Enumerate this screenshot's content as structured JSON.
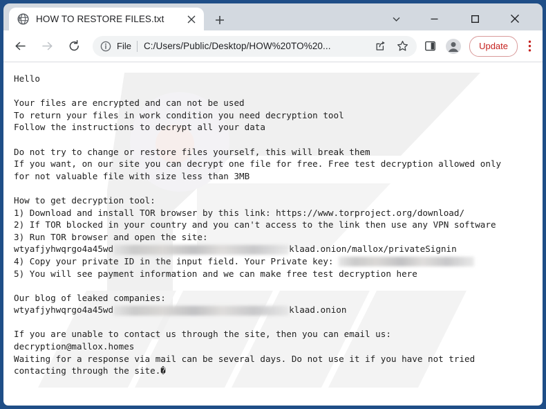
{
  "window": {
    "frame_color": "#1f4e87",
    "titlebar_color": "#d3d9e0",
    "controls": {
      "chevron_label": "v",
      "minimize_label": "minimize",
      "maximize_label": "maximize",
      "close_label": "close"
    }
  },
  "tab": {
    "favicon": "globe-icon",
    "title": "HOW TO RESTORE FILES.txt",
    "close_label": "close-tab",
    "new_tab_label": "new-tab"
  },
  "toolbar": {
    "back_label": "back",
    "forward_label": "forward",
    "reload_label": "reload",
    "info_icon": "info-circle-icon",
    "scheme_label": "File",
    "url": "C:/Users/Public/Desktop/HOW%20TO%20...",
    "share_icon": "share-icon",
    "bookmark_icon": "star-icon",
    "sidepanel_icon": "side-panel-icon",
    "profile_icon": "profile-avatar-icon",
    "update_label": "Update",
    "update_color": "#c5221f",
    "menu_icon": "three-dot-menu-icon"
  },
  "note": {
    "lines": [
      {
        "text": "Hello"
      },
      {
        "text": ""
      },
      {
        "text": "Your files are encrypted and can not be used"
      },
      {
        "text": "To return your files in work condition you need decryption tool"
      },
      {
        "text": "Follow the instructions to decrypt all your data"
      },
      {
        "text": ""
      },
      {
        "text": "Do not try to change or restore files yourself, this will break them"
      },
      {
        "text": "If you want, on our site you can decrypt one file for free. Free test decryption allowed only"
      },
      {
        "text": "for not valuable file with size less than 3MB"
      },
      {
        "text": ""
      },
      {
        "text": "How to get decryption tool:"
      },
      {
        "text": "1) Download and install TOR browser by this link: https://www.torproject.org/download/"
      },
      {
        "text": "2) If TOR blocked in your country and you can't access to the link then use any VPN software"
      },
      {
        "text": "3) Run TOR browser and open the site:"
      },
      {
        "prefix": "wtyafjyhwqrgo4a45wd",
        "redacted_width": 254,
        "suffix": "klaad.onion/mallox/privateSignin"
      },
      {
        "prefix": "4) Copy your private ID in the input field. Your Private key: ",
        "redacted_width": 196,
        "suffix": ""
      },
      {
        "text": "5) You will see payment information and we can make free test decryption here"
      },
      {
        "text": ""
      },
      {
        "text": "Our blog of leaked companies:"
      },
      {
        "prefix": "wtyafjyhwqrgo4a45wd",
        "redacted_width": 254,
        "suffix": "klaad.onion"
      },
      {
        "text": ""
      },
      {
        "text": "If you are unable to contact us through the site, then you can email us:"
      },
      {
        "text": "decryption@mallox.homes"
      },
      {
        "text": "Waiting for a response via mail can be several days. Do not use it if you have not tried"
      },
      {
        "text": "contacting through the site.�"
      }
    ]
  }
}
